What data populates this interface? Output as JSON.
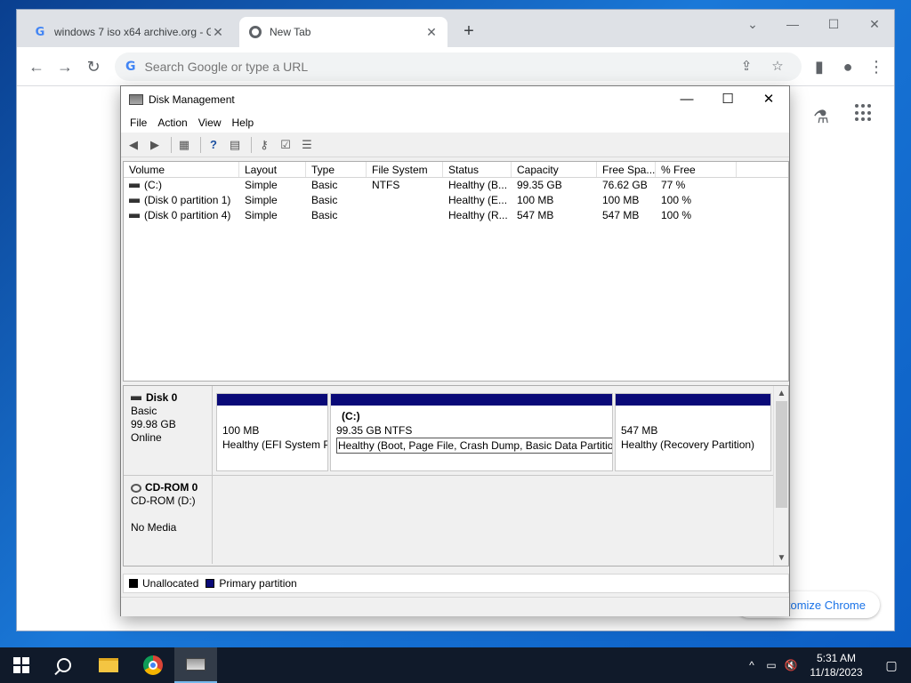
{
  "browser": {
    "tabs": [
      {
        "title": "windows 7 iso x64 archive.org - G",
        "favicon": "google-g-icon"
      },
      {
        "title": "New Tab",
        "favicon": "chrome-icon"
      }
    ],
    "omnibox_placeholder": "Search Google or type a URL",
    "customize_label": "Customize Chrome",
    "icons": {
      "g": "G",
      "plus": "+",
      "close": "✕",
      "back": "←",
      "forward": "→",
      "reload": "↻",
      "share": "⇪",
      "star": "☆",
      "sidepanel": "▮",
      "profile": "●",
      "menu": "⋮",
      "labs": "⚗",
      "chevron": "⌄",
      "minimize": "—",
      "maximize": "☐"
    }
  },
  "disk_management": {
    "title": "Disk Management",
    "window_icons": {
      "minimize": "—",
      "maximize": "☐",
      "close": "✕"
    },
    "menu": [
      "File",
      "Action",
      "View",
      "Help"
    ],
    "toolbar_icons": [
      "back-arrow-icon",
      "forward-arrow-icon",
      "properties-grid-icon",
      "help-icon",
      "console-view-icon",
      "key-icon",
      "check-icon",
      "list-icon"
    ],
    "columns": [
      "Volume",
      "Layout",
      "Type",
      "File System",
      "Status",
      "Capacity",
      "Free Spa...",
      "% Free",
      ""
    ],
    "volumes": [
      {
        "volume": "(C:)",
        "layout": "Simple",
        "type": "Basic",
        "fs": "NTFS",
        "status": "Healthy (B...",
        "capacity": "99.35 GB",
        "free": "76.62 GB",
        "pct": "77 %"
      },
      {
        "volume": "(Disk 0 partition 1)",
        "layout": "Simple",
        "type": "Basic",
        "fs": "",
        "status": "Healthy (E...",
        "capacity": "100 MB",
        "free": "100 MB",
        "pct": "100 %"
      },
      {
        "volume": "(Disk 0 partition 4)",
        "layout": "Simple",
        "type": "Basic",
        "fs": "",
        "status": "Healthy (R...",
        "capacity": "547 MB",
        "free": "547 MB",
        "pct": "100 %"
      }
    ],
    "disk0": {
      "name": "Disk 0",
      "kind": "Basic",
      "size": "99.98 GB",
      "state": "Online",
      "partitions": [
        {
          "name": "",
          "size": "100 MB",
          "status": "Healthy (EFI System P"
        },
        {
          "name": "(C:)",
          "size": "99.35 GB NTFS",
          "status": "Healthy (Boot, Page File, Crash Dump, Basic Data Partition)"
        },
        {
          "name": "",
          "size": "547 MB",
          "status": "Healthy (Recovery Partition)"
        }
      ]
    },
    "cdrom0": {
      "name": "CD-ROM 0",
      "drive": "CD-ROM (D:)",
      "media": "No Media"
    },
    "legend": [
      {
        "label": "Unallocated",
        "color": "#000000"
      },
      {
        "label": "Primary partition",
        "color": "#0a0a78"
      }
    ],
    "scroll_arrows": {
      "up": "▲",
      "down": "▼"
    }
  },
  "taskbar": {
    "apps": [
      "start-button",
      "search",
      "file-explorer",
      "chrome",
      "disk-management"
    ],
    "tray": {
      "chevron": "^",
      "network": "▭",
      "volume": "🔇",
      "notification": "▢"
    },
    "time": "5:31 AM",
    "date": "11/18/2023"
  }
}
